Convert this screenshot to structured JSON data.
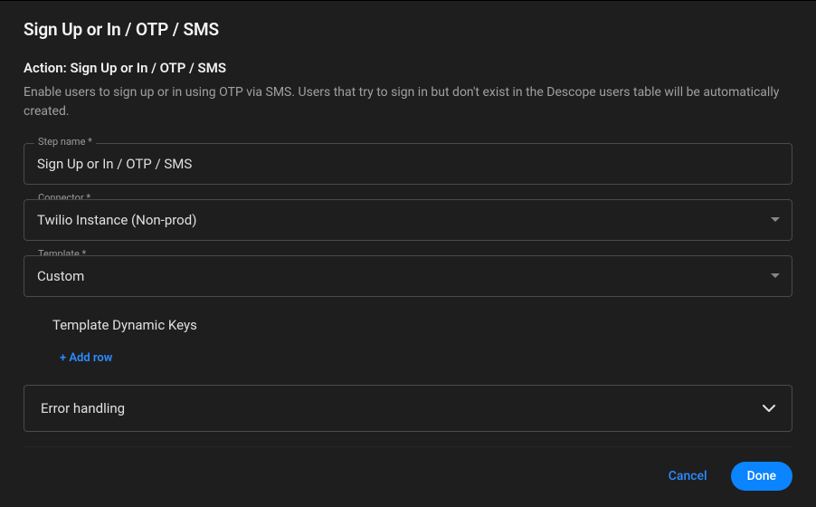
{
  "header": {
    "title": "Sign Up or In / OTP / SMS",
    "subtitle": "Action: Sign Up or In / OTP / SMS",
    "description": "Enable users to sign up or in using OTP via SMS. Users that try to sign in but don't exist in the Descope users table will be automatically created."
  },
  "fields": {
    "step_name": {
      "label": "Step name *",
      "value": "Sign Up or In / OTP / SMS"
    },
    "connector": {
      "label": "Connector *",
      "value": "Twilio Instance (Non-prod)"
    },
    "template": {
      "label": "Template *",
      "value": "Custom"
    }
  },
  "template_section": {
    "title": "Template Dynamic Keys",
    "add_row_label": "+ Add row"
  },
  "accordion": {
    "error_handling": "Error handling"
  },
  "footer": {
    "cancel": "Cancel",
    "done": "Done"
  }
}
